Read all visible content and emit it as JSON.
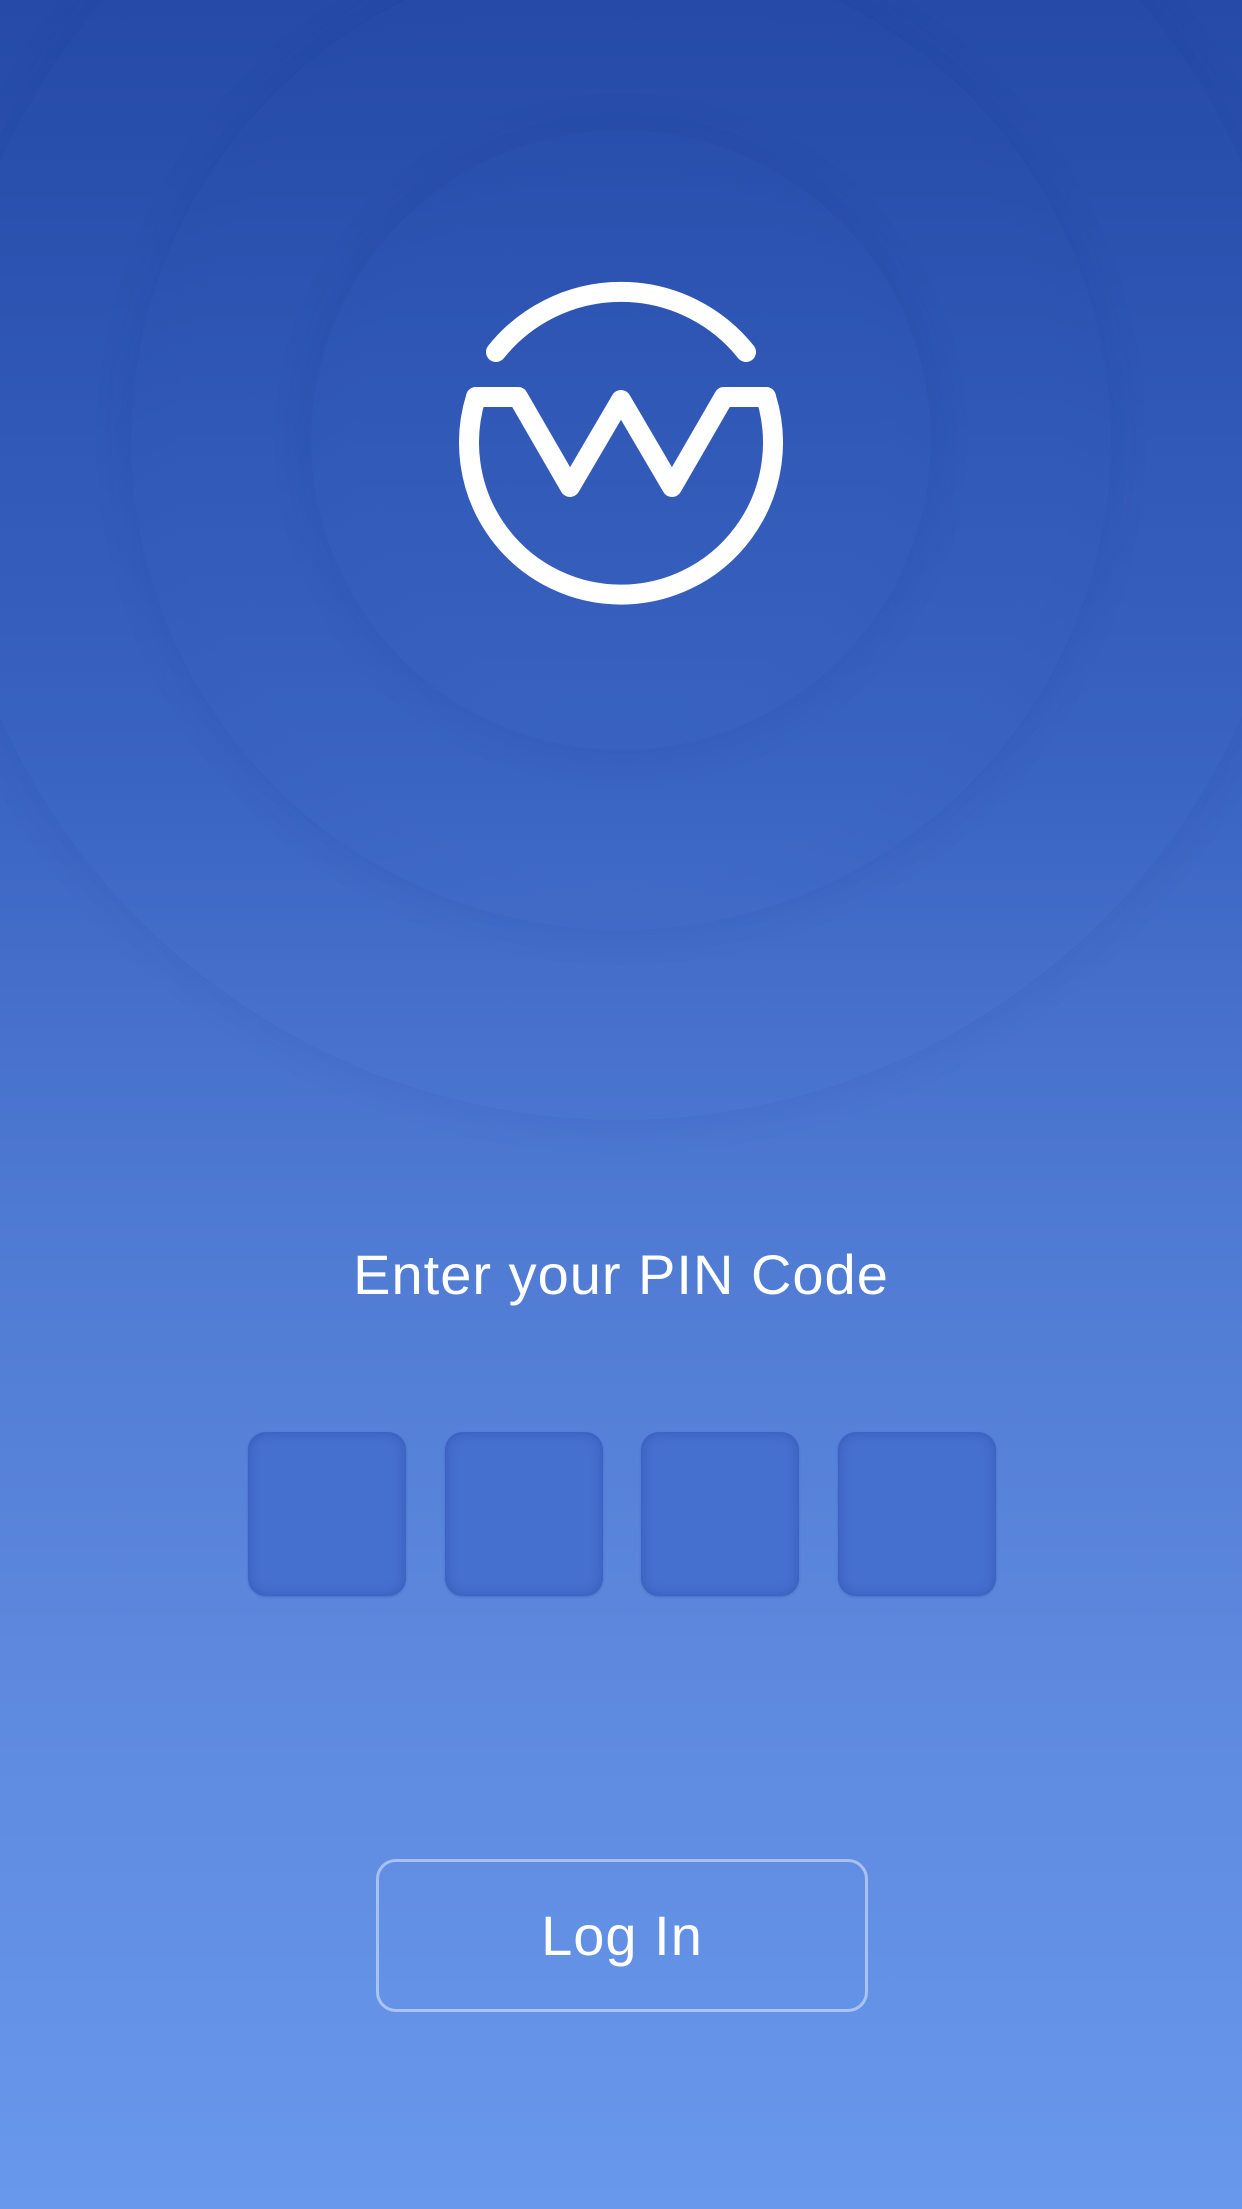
{
  "app": {
    "logo_icon": "w-circle-logo-icon"
  },
  "pin": {
    "prompt": "Enter your PIN Code",
    "digits": [
      "",
      "",
      "",
      ""
    ]
  },
  "actions": {
    "login_label": "Log In"
  },
  "colors": {
    "background_top": "#254aa8",
    "background_bottom": "#6898eb",
    "pin_box": "#4670d0",
    "text": "#ffffff"
  }
}
